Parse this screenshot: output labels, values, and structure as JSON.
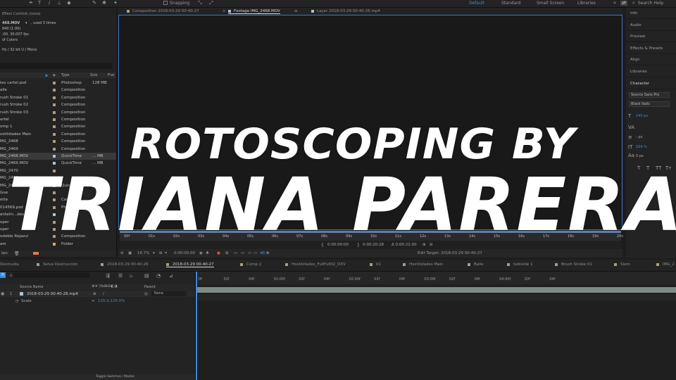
{
  "toolbar": {
    "snapping_label": "Snapping",
    "workspaces": [
      "Default",
      "Standard",
      "Small Screen",
      "Libraries"
    ],
    "active_workspace": "Default",
    "search_help": "Search Help",
    "search_icon": "search-icon"
  },
  "effect_controls": {
    "title": "Effect Controls (none)",
    "file_name": "468.MOV",
    "used": ", used 3 times",
    "line_1": "840 (1.00)",
    "line_2": ";00, 30.007 fps",
    "line_3": "of Colors",
    "line_4": "Hz / 32 bit U / Mono"
  },
  "project": {
    "columns": {
      "type": "Type",
      "size": "Size",
      "frame": "Frar"
    },
    "items": [
      {
        "name": "tes cartel.psd",
        "type": "Photoshop",
        "size": "128 MB",
        "color": "#b29b7a"
      },
      {
        "name": "aile",
        "type": "Composition",
        "size": "",
        "color": "#b29b7a"
      },
      {
        "name": "rush Stroke 01",
        "type": "Composition",
        "size": "",
        "color": "#b29b7a"
      },
      {
        "name": "rush Stroke 02",
        "type": "Composition",
        "size": "",
        "color": "#b29b7a"
      },
      {
        "name": "rush Stroke 03",
        "type": "Composition",
        "size": "",
        "color": "#b29b7a"
      },
      {
        "name": "artel",
        "type": "Composition",
        "size": "",
        "color": "#b29b7a"
      },
      {
        "name": "omp 1",
        "type": "Composition",
        "size": "",
        "color": "#b29b7a"
      },
      {
        "name": "ostilidades Main",
        "type": "Composition",
        "size": "",
        "color": "#b29b7a"
      },
      {
        "name": "MG_2468",
        "type": "Composition",
        "size": "",
        "color": "#b29b7a"
      },
      {
        "name": "MG_2469",
        "type": "Composition",
        "size": "",
        "color": "#b29b7a"
      },
      {
        "name": "MG_2468.MOV",
        "type": "QuickTime",
        "size": "... MB",
        "color": "#a9c4d6",
        "selected": true
      },
      {
        "name": "MG_2469.MOV",
        "type": "QuickTime",
        "size": "... MB",
        "color": "#a9c4d6"
      },
      {
        "name": "MG_2470",
        "type": "",
        "size": "",
        "color": "#b29b7a"
      },
      {
        "name": "MG_2490",
        "type": "",
        "size": "",
        "color": "#b29b7a"
      },
      {
        "name": "MG_2491.MOV",
        "type": "Quic",
        "size": "",
        "color": "#a9c4d6"
      },
      {
        "name": "Gue",
        "type": "",
        "size": "",
        "color": "#b29b7a"
      },
      {
        "name": "ette",
        "type": "Cor",
        "size": "",
        "color": "#b29b7a"
      },
      {
        "name": "014569.psd",
        "type": "Ph",
        "size": "",
        "color": "#b29b7a"
      },
      {
        "name": "entelin...des (.mp3",
        "type": "",
        "size": "",
        "color": "#a9c4d6"
      },
      {
        "name": "oper",
        "type": "",
        "size": "",
        "color": "#b29b7a"
      },
      {
        "name": "oper",
        "type": "",
        "size": "",
        "color": "#b29b7a"
      },
      {
        "name": "odoble Rojazul",
        "type": "Composition",
        "size": "",
        "color": "#b29b7a"
      },
      {
        "name": "am",
        "type": "Folder",
        "size": "",
        "color": "#e1a94b"
      }
    ],
    "footer_label": "bpc"
  },
  "viewer": {
    "tabs": [
      {
        "label": "Composition 2018-03-29 00-40-27",
        "active": false,
        "color": "#b29b7a"
      },
      {
        "label": "Footage IMG_2468.MOV",
        "active": true,
        "color": "#a9c4d6"
      },
      {
        "label": "Layer 2018-03-29 00-40-26.mp4",
        "active": false,
        "color": "#a9c4d6"
      }
    ],
    "ruler_ticks": [
      "00f",
      "01s",
      "02s",
      "03s",
      "04s",
      "05s",
      "06s",
      "07s",
      "08s",
      "09s",
      "10s",
      "11s",
      "12s",
      "13s",
      "14s",
      "15s",
      "16s",
      "17s",
      "18s",
      "19s",
      "20s"
    ],
    "time_start": "0:00:00:00",
    "time_end": "0:00:20:28",
    "time_duration": "Δ 0:00:21:00",
    "zoom": "16.7%",
    "current_time": "0:00:00:00",
    "exposure": "+0.0",
    "edit_target": "Edit Target: 2018-03-29 00-40-27"
  },
  "right_panel": {
    "items": [
      "Info",
      "Audio",
      "Preview",
      "Effects & Presets",
      "Align",
      "Libraries",
      "Character"
    ],
    "font_family": "Source Sans Pro",
    "font_style": "Black Italic",
    "font_size": "145 px",
    "leading": "- px",
    "vertical_scale": "104 %",
    "tracking": "0 px",
    "text_buttons": [
      "T",
      "T",
      "TT",
      "Tт"
    ],
    "paragraph_label": "Pa"
  },
  "timeline": {
    "tabs": [
      {
        "label": "Destruida",
        "color": "#b29b7a",
        "active": false
      },
      {
        "label": "Selva Destruccion",
        "color": "#b29b7a",
        "active": false
      },
      {
        "label": "2018-03-29 00-40-26",
        "color": "#b29b7a",
        "active": false
      },
      {
        "label": "2018-03-29 00-40-27",
        "color": "#b29b7a",
        "active": true
      },
      {
        "label": "Comp 2",
        "color": "#b29b7a",
        "active": false
      },
      {
        "label": "Hostilidades_FullFull02_DXV",
        "color": "#b29b7a",
        "active": false
      },
      {
        "label": "01",
        "color": "#b29b7a",
        "active": false
      },
      {
        "label": "Hostilidades Main",
        "color": "#b29b7a",
        "active": false
      },
      {
        "label": "Baile",
        "color": "#b29b7a",
        "active": false
      },
      {
        "label": "tabloide 1",
        "color": "#b29b7a",
        "active": false
      },
      {
        "label": "Brush Stroke 01",
        "color": "#b29b7a",
        "active": false
      },
      {
        "label": "Slam",
        "color": "#b29b7a",
        "active": false
      },
      {
        "label": "IMG_2",
        "color": "#b29b7a",
        "active": false
      }
    ],
    "source_name_header": "Source Name",
    "parent_header": "Parent",
    "layer_number": "1",
    "layer_name": "2018-03-29 00-40-26.mp4",
    "parent_value": "None",
    "scale_label": "Scale",
    "scale_value": "125.0,125.0%",
    "ticks": [
      "0f",
      "02f",
      "04f",
      "01:00f",
      "02f",
      "04f",
      "02:00f",
      "02f",
      "04f",
      "03:00f",
      "02f",
      "04f",
      "04:00f",
      "02f",
      "04f"
    ],
    "footer_label": "Toggle Switches / Modes"
  },
  "overlay": {
    "line_1": "ROTOSCOPING BY",
    "line_2": "TRIANA PARERA"
  }
}
